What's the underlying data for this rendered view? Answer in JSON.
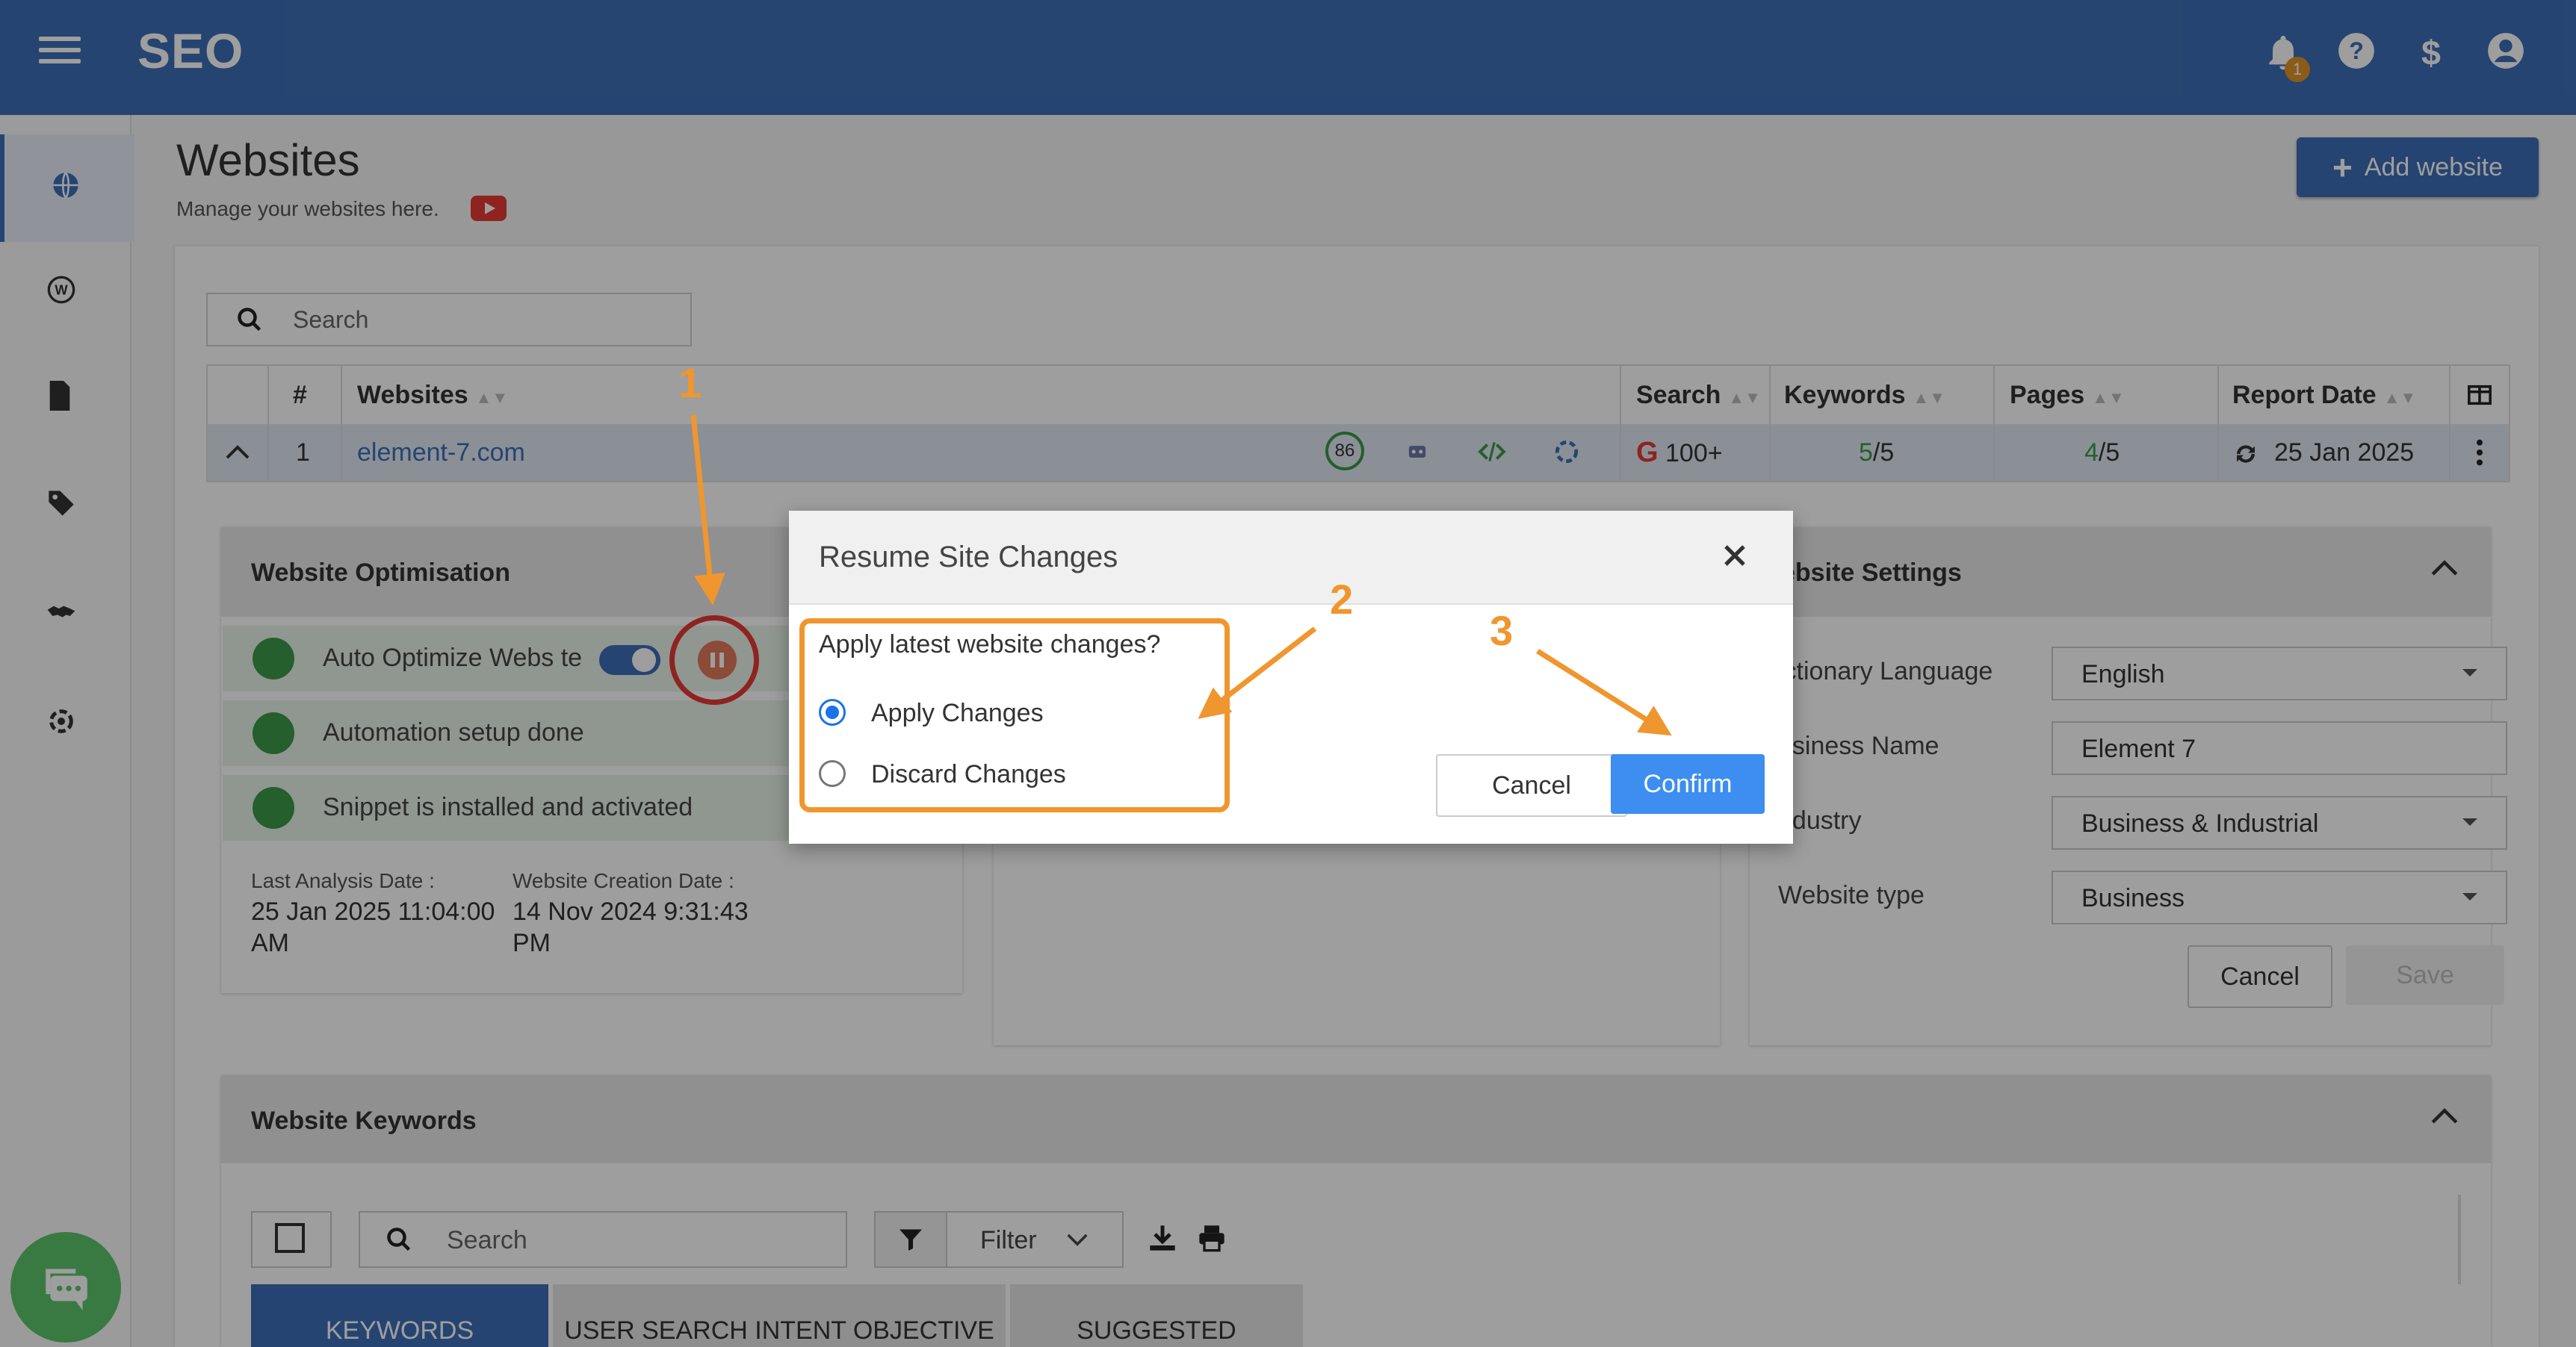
{
  "app": {
    "brand": "SEO",
    "notification_count": "1"
  },
  "page": {
    "title": "Websites",
    "subtitle": "Manage your websites here.",
    "add_button": "Add website"
  },
  "search": {
    "placeholder": "Search"
  },
  "table": {
    "headers": {
      "num": "#",
      "websites": "Websites",
      "search": "Search",
      "keywords": "Keywords",
      "pages": "Pages",
      "report_date": "Report Date"
    },
    "row": {
      "num": "1",
      "website": "element-7.com",
      "score": "86",
      "search_value": "100+",
      "keywords_done": "5",
      "keywords_total": "/5",
      "pages_done": "4",
      "pages_total": "/5",
      "report_date": "25 Jan 2025"
    }
  },
  "optimisation": {
    "title": "Website Optimisation",
    "steps": [
      "Auto Optimize Webs te",
      "Automation setup done",
      "Snippet is installed and activated"
    ],
    "last_analysis_label": "Last Analysis Date :",
    "last_analysis_value": "25 Jan 2025 11:04:00 AM",
    "creation_label": "Website Creation Date :",
    "creation_value": "14 Nov 2024 9:31:43 PM"
  },
  "settings": {
    "title": "ebsite Settings",
    "fields": [
      {
        "label": "ictionary Language",
        "value": "English"
      },
      {
        "label": "usiness Name",
        "value": "Element 7"
      },
      {
        "label": "ndustry",
        "value": "Business & Industrial"
      },
      {
        "label": "Website type",
        "value": "Business"
      }
    ],
    "cancel": "Cancel",
    "save": "Save"
  },
  "keywords_panel": {
    "title": "Website Keywords",
    "search_placeholder": "Search",
    "filter_label": "Filter",
    "tabs": [
      "KEYWORDS",
      "USER SEARCH INTENT OBJECTIVE",
      "SUGGESTED"
    ]
  },
  "modal": {
    "title": "Resume Site Changes",
    "question": "Apply latest website changes?",
    "options": [
      "Apply Changes",
      "Discard Changes"
    ],
    "selected": "Apply Changes",
    "cancel": "Cancel",
    "confirm": "Confirm"
  },
  "annotations": [
    "1",
    "2",
    "3"
  ],
  "colors": {
    "brand": "#3d6fb6",
    "accent": "#f0962e",
    "success": "#3a9a4a",
    "primary_button": "#3d8ef0",
    "danger": "#e53935"
  }
}
